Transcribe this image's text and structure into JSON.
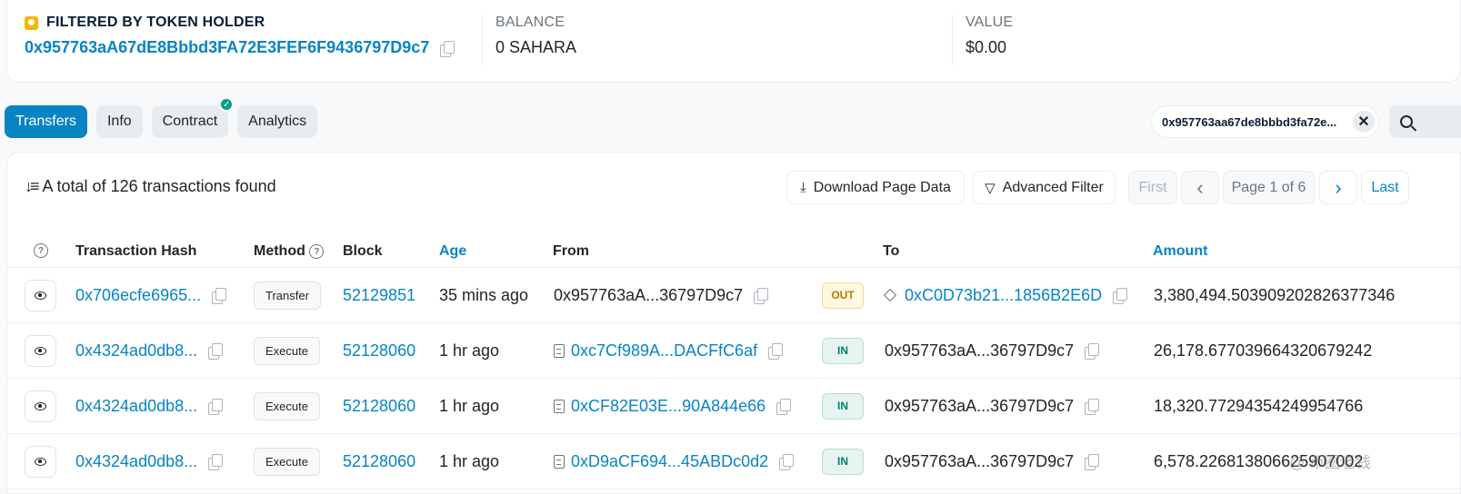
{
  "header": {
    "holder_label": "FILTERED BY TOKEN HOLDER",
    "holder_address": "0x957763aA67dE8Bbbd3FA72E3FEF6F9436797D9c7",
    "balance_label": "BALANCE",
    "balance_value": "0 SAHARA",
    "value_label": "VALUE",
    "value_value": "$0.00"
  },
  "tabs": [
    {
      "label": "Transfers",
      "active": true
    },
    {
      "label": "Info",
      "active": false
    },
    {
      "label": "Contract",
      "active": false,
      "verified": true
    },
    {
      "label": "Analytics",
      "active": false
    }
  ],
  "filter_chip": {
    "text": "0x957763aa67de8bbbd3fa72e...",
    "close": "✕"
  },
  "summary": {
    "text": "A total of 126 transactions found"
  },
  "buttons": {
    "download": "Download Page Data",
    "advanced_filter": "Advanced Filter"
  },
  "pagination": {
    "first": "First",
    "prev": "‹",
    "page_info": "Page 1 of 6",
    "next": "›",
    "last": "Last"
  },
  "columns": {
    "tx_hash": "Transaction Hash",
    "method": "Method",
    "block": "Block",
    "age": "Age",
    "from": "From",
    "to": "To",
    "amount": "Amount"
  },
  "rows": [
    {
      "tx_hash": "0x706ecfe6965...",
      "method": "Transfer",
      "block": "52129851",
      "age": "35 mins ago",
      "from": "0x957763aA...36797D9c7",
      "direction": "OUT",
      "to": "0xC0D73b21...1856B2E6D",
      "amount": "3,380,494.503909202826377346"
    },
    {
      "tx_hash": "0x4324ad0db8...",
      "method": "Execute",
      "block": "52128060",
      "age": "1 hr ago",
      "from": "0xc7Cf989A...DACFfC6af",
      "direction": "IN",
      "to": "0x957763aA...36797D9c7",
      "amount": "26,178.677039664320679242"
    },
    {
      "tx_hash": "0x4324ad0db8...",
      "method": "Execute",
      "block": "52128060",
      "age": "1 hr ago",
      "from": "0xCF82E03E...90A844e66",
      "direction": "IN",
      "to": "0x957763aA...36797D9c7",
      "amount": "18,320.77294354249954766"
    },
    {
      "tx_hash": "0x4324ad0db8...",
      "method": "Execute",
      "block": "52128060",
      "age": "1 hr ago",
      "from": "0xD9aCF694...45ABDc0d2",
      "direction": "IN",
      "to": "0x957763aA...36797D9c7",
      "amount": "6,578.226813806625907002"
    }
  ],
  "watermark": "@ 币圈老钱"
}
